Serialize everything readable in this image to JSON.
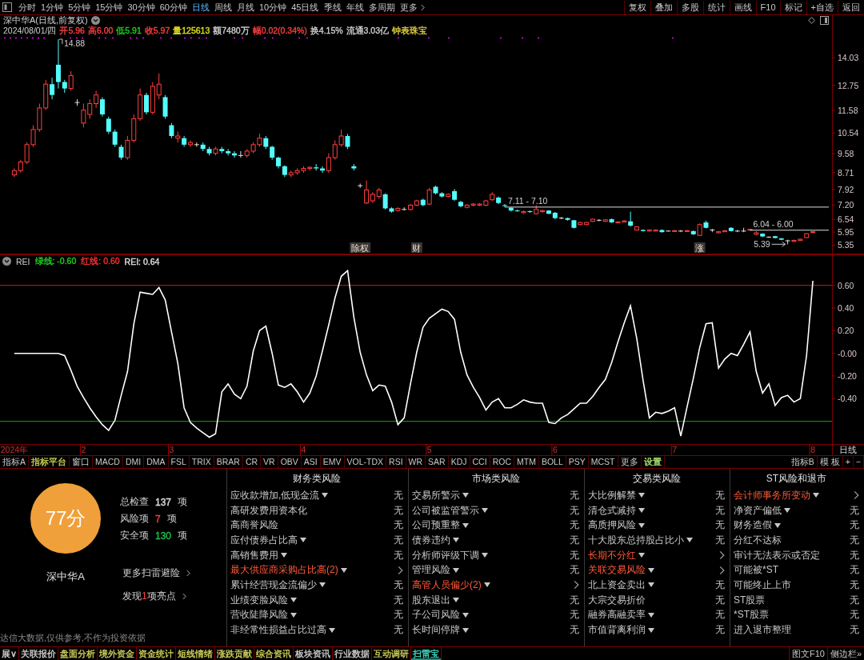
{
  "toolbar": {
    "periods": [
      {
        "label": "分时",
        "selected": false
      },
      {
        "label": "1分钟",
        "selected": false
      },
      {
        "label": "5分钟",
        "selected": false
      },
      {
        "label": "15分钟",
        "selected": false
      },
      {
        "label": "30分钟",
        "selected": false
      },
      {
        "label": "60分钟",
        "selected": false
      },
      {
        "label": "日线",
        "selected": true
      },
      {
        "label": "周线",
        "selected": false
      },
      {
        "label": "月线",
        "selected": false
      },
      {
        "label": "10分钟",
        "selected": false
      },
      {
        "label": "45日线",
        "selected": false
      },
      {
        "label": "季线",
        "selected": false
      },
      {
        "label": "年线",
        "selected": false
      },
      {
        "label": "多周期",
        "selected": false
      }
    ],
    "more": {
      "label": "更多"
    },
    "actions": [
      {
        "label": "复权"
      },
      {
        "label": "叠加"
      },
      {
        "label": "多股"
      },
      {
        "label": "统计"
      },
      {
        "label": "画线"
      },
      {
        "label": "F10"
      },
      {
        "label": "标记"
      },
      {
        "label": "+自选"
      },
      {
        "label": "返回"
      }
    ]
  },
  "price_pane": {
    "title": "深中华A(日线,前复权)",
    "quote": {
      "date": "2024/08/01/四",
      "fields": [
        {
          "text": "开5.96",
          "color": "#ff4040"
        },
        {
          "text": "高6.00",
          "color": "#ff4040"
        },
        {
          "text": "低5.91",
          "color": "#20d020"
        },
        {
          "text": "收5.97",
          "color": "#ff4040"
        },
        {
          "text": "量125613",
          "color": "#e0e020"
        },
        {
          "text": "额7480万",
          "color": "#d0d0d0"
        },
        {
          "text": "幅0.02(0.34%)",
          "color": "#ff4040"
        },
        {
          "text": "换4.15%",
          "color": "#d0d0d0"
        },
        {
          "text": "流通3.03亿",
          "color": "#d0d0d0"
        },
        {
          "text": "钟表珠宝",
          "color": "#e0d040"
        }
      ]
    },
    "chart_data": [
      {
        "type": "candlestick",
        "categories": [
          null,
          null,
          null,
          null,
          null,
          null,
          null,
          null,
          null,
          null,
          null,
          null,
          null,
          null,
          null,
          null,
          null,
          null,
          null,
          null,
          null,
          null,
          null,
          null,
          null,
          null,
          null,
          null,
          null,
          null,
          null,
          null,
          null,
          null,
          null,
          null,
          null,
          null,
          null,
          null,
          null,
          null,
          null,
          null,
          null,
          null,
          null,
          null,
          null,
          null,
          null,
          null,
          null,
          null,
          null,
          "除权",
          null,
          null,
          null,
          null,
          null,
          null,
          null,
          null,
          "财",
          null,
          null,
          null,
          null,
          null,
          null,
          null,
          null,
          null,
          null,
          null,
          null,
          null,
          null,
          null,
          null,
          null,
          null,
          null,
          null,
          null,
          null,
          null,
          null,
          null,
          null,
          null,
          null,
          null,
          null,
          null,
          null,
          null,
          null,
          null,
          null,
          null,
          null,
          null,
          null,
          null,
          null,
          null,
          null,
          "涨",
          null,
          null,
          null,
          null,
          null,
          null,
          null,
          null,
          null,
          null,
          null,
          null,
          null,
          null,
          null,
          null,
          null,
          null
        ],
        "ylim": [
          4.92,
          16.03
        ],
        "yticks": [
          14.03,
          12.75,
          11.58,
          10.54,
          9.58,
          8.71,
          7.92,
          {
            "value": 7.2,
            "label": "7.20"
          },
          6.54,
          5.95,
          5.35
        ],
        "ref_lines": [
          {
            "axis": "y",
            "value": 7.11,
            "label": "7.11 - 7.10",
            "color": "#e0e0e0"
          },
          {
            "axis": "y",
            "value": 6.04,
            "label": "6.04 - 6.00",
            "color": "#e0e0e0"
          }
        ],
        "ohlc": [
          [
            8.6,
            8.9,
            8.5,
            8.8
          ],
          [
            8.8,
            9.3,
            8.7,
            9.2
          ],
          [
            9.2,
            10.1,
            9.1,
            10.0
          ],
          [
            10.0,
            10.9,
            9.9,
            10.7
          ],
          [
            10.7,
            11.9,
            10.6,
            11.7
          ],
          [
            11.7,
            13.0,
            11.6,
            12.8
          ],
          [
            12.8,
            13.1,
            12.1,
            12.3
          ],
          [
            13.7,
            14.88,
            12.6,
            12.9
          ],
          [
            12.9,
            13.0,
            12.4,
            12.6
          ],
          [
            12.6,
            13.4,
            12.5,
            13.2
          ],
          [
            11.95,
            12.1,
            11.8,
            11.95
          ],
          [
            11.0,
            11.9,
            10.8,
            11.6
          ],
          [
            11.4,
            12.1,
            11.2,
            11.9
          ],
          [
            11.9,
            12.5,
            11.7,
            12.3
          ],
          [
            12.1,
            12.2,
            11.3,
            11.4
          ],
          [
            11.2,
            11.3,
            10.5,
            10.6
          ],
          [
            10.6,
            10.7,
            9.9,
            10.0
          ],
          [
            9.9,
            10.0,
            9.3,
            9.4
          ],
          [
            9.4,
            10.4,
            9.3,
            10.2
          ],
          [
            10.2,
            11.4,
            10.1,
            11.2
          ],
          [
            11.2,
            12.6,
            11.1,
            12.3
          ],
          [
            12.3,
            12.4,
            11.4,
            11.5
          ],
          [
            11.5,
            12.9,
            11.4,
            12.7
          ],
          [
            12.3,
            13.3,
            12.1,
            12.8
          ],
          [
            12.2,
            12.3,
            11.2,
            11.3
          ],
          [
            10.9,
            11.0,
            10.3,
            10.4
          ],
          [
            10.3,
            10.6,
            10.1,
            10.4
          ],
          [
            10.3,
            10.4,
            9.9,
            10.0
          ],
          [
            10.0,
            10.2,
            9.9,
            10.1
          ],
          [
            10.0,
            10.1,
            9.9,
            10.0
          ],
          [
            10.0,
            10.1,
            9.7,
            9.8
          ],
          [
            9.8,
            9.9,
            9.5,
            9.6
          ],
          [
            9.6,
            9.9,
            9.5,
            9.8
          ],
          [
            9.8,
            9.9,
            9.6,
            9.7
          ],
          [
            9.7,
            9.8,
            9.5,
            9.6
          ],
          [
            9.6,
            9.7,
            9.4,
            9.5
          ],
          [
            9.5,
            9.7,
            9.4,
            9.5
          ],
          [
            9.5,
            9.8,
            9.4,
            9.7
          ],
          [
            9.7,
            10.1,
            9.6,
            10.0
          ],
          [
            10.0,
            10.5,
            9.9,
            10.3
          ],
          [
            10.3,
            10.4,
            9.8,
            9.9
          ],
          [
            9.9,
            9.95,
            9.3,
            9.4
          ],
          [
            9.4,
            9.45,
            8.9,
            9.0
          ],
          [
            9.0,
            9.05,
            8.5,
            8.6
          ],
          [
            8.6,
            8.8,
            8.5,
            8.7
          ],
          [
            8.7,
            8.9,
            8.6,
            8.8
          ],
          [
            8.8,
            9.0,
            8.7,
            8.9
          ],
          [
            8.9,
            9.0,
            8.8,
            8.95
          ],
          [
            8.95,
            9.1,
            8.8,
            8.9
          ],
          [
            8.9,
            9.0,
            8.7,
            8.8
          ],
          [
            8.8,
            9.6,
            8.7,
            9.4
          ],
          [
            9.4,
            10.2,
            9.3,
            10.0
          ],
          [
            10.0,
            10.7,
            9.9,
            10.4
          ],
          [
            10.4,
            10.5,
            9.8,
            9.9
          ],
          [
            9.0,
            9.1,
            8.8,
            8.9
          ],
          [
            8.1,
            8.2,
            8.0,
            8.1
          ],
          [
            7.3,
            8.35,
            7.25,
            7.9
          ],
          [
            7.4,
            7.8,
            7.3,
            7.7
          ],
          [
            7.6,
            8.0,
            7.5,
            7.9
          ],
          [
            7.7,
            7.75,
            7.0,
            7.05
          ],
          [
            7.05,
            7.1,
            6.85,
            6.9
          ],
          [
            6.95,
            7.1,
            6.9,
            7.05
          ],
          [
            7.0,
            7.1,
            6.95,
            7.0
          ],
          [
            7.0,
            7.25,
            6.95,
            7.2
          ],
          [
            7.2,
            7.45,
            7.15,
            7.4
          ],
          [
            7.45,
            7.5,
            7.15,
            7.2
          ],
          [
            7.25,
            8.0,
            7.2,
            7.9
          ],
          [
            8.05,
            8.1,
            7.7,
            7.75
          ],
          [
            7.75,
            7.8,
            7.55,
            7.6
          ],
          [
            7.6,
            7.75,
            7.55,
            7.7
          ],
          [
            7.85,
            7.95,
            7.4,
            7.45
          ],
          [
            7.35,
            7.4,
            7.1,
            7.15
          ],
          [
            7.1,
            7.25,
            7.05,
            7.2
          ],
          [
            7.2,
            7.3,
            7.15,
            7.25
          ],
          [
            7.2,
            7.3,
            7.15,
            7.25
          ],
          [
            7.2,
            7.45,
            7.15,
            7.4
          ],
          [
            7.45,
            7.8,
            7.4,
            7.7
          ],
          [
            7.55,
            7.6,
            7.25,
            7.3
          ],
          [
            7.2,
            7.25,
            7.11,
            7.18
          ],
          [
            7.08,
            7.1,
            6.9,
            6.95
          ],
          [
            6.95,
            7.0,
            6.9,
            6.92
          ],
          [
            6.85,
            6.95,
            6.8,
            6.9
          ],
          [
            6.92,
            6.95,
            6.85,
            6.88
          ],
          [
            6.8,
            7.2,
            6.78,
            7.0
          ],
          [
            6.9,
            6.98,
            6.85,
            6.95
          ],
          [
            6.95,
            6.97,
            6.78,
            6.8
          ],
          [
            6.85,
            6.88,
            6.55,
            6.6
          ],
          [
            6.6,
            6.65,
            6.55,
            6.6
          ],
          [
            6.6,
            6.62,
            6.48,
            6.52
          ],
          [
            6.5,
            6.52,
            6.12,
            6.15
          ],
          [
            6.3,
            6.42,
            6.28,
            6.4
          ],
          [
            6.3,
            6.42,
            6.28,
            6.4
          ],
          [
            6.45,
            6.58,
            6.42,
            6.55
          ],
          [
            6.5,
            6.55,
            6.45,
            6.5
          ],
          [
            6.45,
            6.55,
            6.42,
            6.52
          ],
          [
            6.55,
            6.58,
            6.38,
            6.4
          ],
          [
            6.38,
            6.45,
            6.35,
            6.42
          ],
          [
            6.42,
            6.5,
            6.4,
            6.47
          ],
          [
            6.45,
            6.9,
            6.2,
            6.25
          ],
          [
            6.05,
            6.22,
            6.02,
            6.2
          ],
          [
            6.05,
            6.08,
            5.98,
            6.0
          ],
          [
            6.0,
            6.08,
            5.98,
            6.05
          ],
          [
            6.0,
            6.08,
            5.98,
            6.05
          ],
          [
            6.05,
            6.08,
            5.93,
            5.95
          ],
          [
            6.0,
            6.02,
            5.98,
            6.0
          ],
          [
            5.98,
            6.05,
            5.96,
            6.02
          ],
          [
            6.0,
            6.05,
            5.95,
            6.0
          ],
          [
            5.98,
            6.05,
            5.96,
            6.02
          ],
          [
            6.0,
            6.02,
            5.82,
            5.85
          ],
          [
            5.8,
            6.35,
            5.78,
            6.3
          ],
          [
            6.4,
            6.48,
            6.12,
            6.15
          ],
          [
            6.05,
            6.1,
            5.95,
            6.05
          ],
          [
            5.92,
            6.0,
            5.9,
            5.97
          ],
          [
            5.97,
            6.05,
            5.95,
            6.02
          ],
          [
            6.15,
            6.18,
            5.98,
            6.0
          ],
          [
            6.0,
            6.05,
            5.95,
            6.0
          ],
          [
            6.0,
            6.15,
            5.95,
            6.0
          ],
          [
            6.05,
            6.1,
            6.04,
            6.08
          ],
          [
            5.85,
            6.0,
            5.8,
            5.92
          ],
          [
            5.88,
            5.9,
            5.72,
            5.75
          ],
          [
            5.72,
            5.75,
            5.68,
            5.72
          ],
          [
            5.76,
            5.78,
            5.66,
            5.68
          ],
          [
            5.66,
            5.68,
            5.58,
            5.6
          ],
          [
            5.55,
            5.6,
            5.39,
            5.55
          ],
          [
            5.52,
            5.6,
            5.5,
            5.57
          ],
          [
            5.57,
            5.65,
            5.55,
            5.62
          ],
          [
            5.7,
            5.9,
            5.68,
            5.88
          ],
          [
            5.96,
            6.0,
            5.91,
            5.97
          ]
        ]
      }
    ],
    "extremes": {
      "high": "14.88",
      "low": "5.39"
    }
  },
  "rei_pane": {
    "header": {
      "items": [
        {
          "text": "绿线: -0.60",
          "color": "#20d020"
        },
        {
          "text": "红线: 0.60",
          "color": "#ff3030"
        },
        {
          "text": "REI: 0.64",
          "color": "#e0e0e0"
        }
      ]
    },
    "chart_data": [
      {
        "type": "line",
        "categories": [
          "2024年",
          null,
          null,
          null,
          null,
          null,
          null,
          null,
          null,
          null,
          null,
          "2",
          null,
          null,
          null,
          null,
          null,
          null,
          null,
          null,
          null,
          null,
          null,
          null,
          null,
          "3",
          null,
          null,
          null,
          null,
          null,
          null,
          null,
          null,
          null,
          null,
          null,
          null,
          null,
          null,
          null,
          null,
          null,
          null,
          null,
          null,
          "4",
          null,
          null,
          null,
          null,
          null,
          null,
          null,
          null,
          null,
          null,
          null,
          null,
          null,
          null,
          null,
          null,
          null,
          null,
          null,
          "5",
          null,
          null,
          null,
          null,
          null,
          null,
          null,
          null,
          null,
          null,
          null,
          null,
          null,
          null,
          null,
          null,
          null,
          null,
          null,
          "6",
          null,
          null,
          null,
          null,
          null,
          null,
          null,
          null,
          null,
          null,
          null,
          null,
          null,
          null,
          null,
          null,
          null,
          null,
          "7",
          null,
          null,
          null,
          null,
          null,
          null,
          null,
          null,
          null,
          null,
          null,
          null,
          null,
          null,
          null,
          null,
          null,
          null,
          null,
          null,
          null,
          "8"
        ],
        "series": [
          {
            "name": "REI",
            "color": "#ffffff",
            "values": [
              0,
              0,
              0,
              0,
              0,
              0,
              0,
              0,
              -0.02,
              -0.15,
              -0.29,
              -0.39,
              -0.48,
              -0.56,
              -0.63,
              -0.68,
              -0.59,
              -0.37,
              -0.16,
              0.26,
              0.54,
              0.53,
              0.52,
              0.58,
              0.47,
              0.19,
              -0.09,
              -0.48,
              -0.61,
              -0.66,
              -0.7,
              -0.74,
              -0.71,
              -0.34,
              -0.27,
              -0.36,
              -0.4,
              -0.29,
              0.02,
              0.2,
              0.24,
              0,
              -0.28,
              -0.3,
              -0.27,
              -0.34,
              -0.43,
              -0.35,
              -0.2,
              0.02,
              0.25,
              0.49,
              0.68,
              0.73,
              0.32,
              0.01,
              -0.19,
              -0.33,
              -0.28,
              -0.29,
              -0.43,
              -0.63,
              -0.57,
              -0.27,
              0.01,
              0.23,
              0.31,
              0.35,
              0.39,
              0.37,
              0.3,
              0.01,
              -0.19,
              -0.3,
              -0.39,
              -0.5,
              -0.43,
              -0.4,
              -0.48,
              -0.48,
              -0.45,
              -0.41,
              -0.43,
              -0.44,
              -0.44,
              -0.61,
              -0.62,
              -0.57,
              -0.54,
              -0.49,
              -0.44,
              -0.44,
              -0.38,
              -0.3,
              -0.23,
              -0.08,
              0.1,
              0.27,
              0.42,
              0.13,
              -0.24,
              -0.57,
              -0.52,
              -0.53,
              -0.51,
              -0.48,
              -0.73,
              -0.47,
              -0.22,
              0.05,
              0.26,
              0.27,
              -0.13,
              -0.05,
              0,
              -0.02,
              0.08,
              0.19,
              -0.16,
              -0.35,
              -0.27,
              -0.46,
              -0.39,
              -0.37,
              -0.43,
              -0.4,
              -0.02,
              0.64
            ]
          }
        ],
        "ylim": [
          -0.8,
          0.873
        ],
        "yticks": [
          {
            "value": 0.6,
            "label": "0.60"
          },
          {
            "value": 0.4,
            "label": "0.40"
          },
          {
            "value": 0.2,
            "label": "0.20"
          },
          {
            "value": 0,
            "label": "-0.00"
          },
          {
            "value": -0.2,
            "label": "-0.20"
          },
          {
            "value": -0.4,
            "label": "-0.40"
          }
        ],
        "ref_lines": [
          {
            "axis": "y",
            "value": 0.6,
            "color": "#c81e1e"
          },
          {
            "axis": "y",
            "value": -0.6,
            "color": "#1ea01e"
          }
        ]
      }
    ],
    "period_label": "日线"
  },
  "indicator_bar": {
    "left": [
      {
        "label": "指标A"
      },
      {
        "label": "指标平台",
        "color": "#c8d050"
      },
      {
        "label": "窗口"
      },
      {
        "label": "MACD"
      },
      {
        "label": "DMI"
      },
      {
        "label": "DMA"
      },
      {
        "label": "FSL"
      },
      {
        "label": "TRIX"
      },
      {
        "label": "BRAR"
      },
      {
        "label": "CR"
      },
      {
        "label": "VR"
      },
      {
        "label": "OBV"
      },
      {
        "label": "ASI"
      },
      {
        "label": "EMV"
      },
      {
        "label": "VOL-TDX"
      },
      {
        "label": "RSI"
      },
      {
        "label": "WR"
      },
      {
        "label": "SAR"
      },
      {
        "label": "KDJ"
      },
      {
        "label": "CCI"
      },
      {
        "label": "ROC"
      },
      {
        "label": "MTM"
      },
      {
        "label": "BOLL"
      },
      {
        "label": "PSY"
      },
      {
        "label": "MCST"
      },
      {
        "label": "更多"
      },
      {
        "label": "设置",
        "color": "#a8e070"
      }
    ],
    "right": [
      {
        "label": "指标B"
      },
      {
        "label": "模 板"
      },
      {
        "label": "+"
      },
      {
        "label": "−"
      }
    ]
  },
  "risk_scan": {
    "score": "77分",
    "stock": "深中华A",
    "stats": [
      {
        "label": "总检查",
        "value": "137",
        "unit": "项",
        "color": "#e0e0e0"
      },
      {
        "label": "风险项",
        "value": "7",
        "unit": "项",
        "color": "#ff4040"
      },
      {
        "label": "安全项",
        "value": "130",
        "unit": "项",
        "color": "#20c050"
      }
    ],
    "links": [
      {
        "text": "更多扫雷避险"
      },
      {
        "text": "发现",
        "count": "1",
        "after": "项亮点"
      }
    ],
    "disclaimer": "达信大数据,仅供参考,不作为投资依据",
    "columns": [
      {
        "title": "财务类风险",
        "items": [
          {
            "label": "应收款增加,低现金流",
            "dropdown": true,
            "risk": false,
            "result": "无"
          },
          {
            "label": "高研发费用资本化",
            "dropdown": false,
            "risk": false,
            "result": "无"
          },
          {
            "label": "高商誉风险",
            "dropdown": false,
            "risk": false,
            "result": "无"
          },
          {
            "label": "应付债券占比高",
            "dropdown": true,
            "risk": false,
            "result": "无"
          },
          {
            "label": "高销售费用",
            "dropdown": true,
            "risk": false,
            "result": "无"
          },
          {
            "label": "最大供应商采购占比高(2)",
            "dropdown": true,
            "risk": true
          },
          {
            "label": "累计经营现金流偏少",
            "dropdown": true,
            "risk": false,
            "result": "无"
          },
          {
            "label": "业绩变脸风险",
            "dropdown": true,
            "risk": false,
            "result": "无"
          },
          {
            "label": "营收陡降风险",
            "dropdown": true,
            "risk": false,
            "result": "无"
          },
          {
            "label": "非经常性损益占比过高",
            "dropdown": true,
            "risk": false,
            "result": "无"
          }
        ]
      },
      {
        "title": "市场类风险",
        "items": [
          {
            "label": "交易所警示",
            "dropdown": true,
            "risk": false,
            "result": "无"
          },
          {
            "label": "公司被监管警示",
            "dropdown": true,
            "risk": false,
            "result": "无"
          },
          {
            "label": "公司预重整",
            "dropdown": true,
            "risk": false,
            "result": "无"
          },
          {
            "label": "债券违约",
            "dropdown": true,
            "risk": false,
            "result": "无"
          },
          {
            "label": "分析师评级下调",
            "dropdown": true,
            "risk": false,
            "result": "无"
          },
          {
            "label": "管理风险",
            "dropdown": true,
            "risk": false,
            "result": "无"
          },
          {
            "label": "高管人员偏少(2)",
            "dropdown": true,
            "risk": true
          },
          {
            "label": "股东退出",
            "dropdown": true,
            "risk": false,
            "result": "无"
          },
          {
            "label": "子公司风险",
            "dropdown": true,
            "risk": false,
            "result": "无"
          },
          {
            "label": "长时间停牌",
            "dropdown": true,
            "risk": false,
            "result": "无"
          }
        ]
      },
      {
        "title": "交易类风险",
        "items": [
          {
            "label": "大比例解禁",
            "dropdown": true,
            "risk": false,
            "result": "无"
          },
          {
            "label": "清仓式减持",
            "dropdown": true,
            "risk": false,
            "result": "无"
          },
          {
            "label": "高质押风险",
            "dropdown": true,
            "risk": false,
            "result": "无"
          },
          {
            "label": "十大股东总持股占比小",
            "dropdown": true,
            "risk": false,
            "result": "无"
          },
          {
            "label": "长期不分红",
            "dropdown": true,
            "risk": true
          },
          {
            "label": "关联交易风险",
            "dropdown": true,
            "risk": true
          },
          {
            "label": "北上资金卖出",
            "dropdown": true,
            "risk": false,
            "result": "无"
          },
          {
            "label": "大宗交易折价",
            "dropdown": false,
            "risk": false,
            "result": "无"
          },
          {
            "label": "融券高融卖率",
            "dropdown": true,
            "risk": false,
            "result": "无"
          },
          {
            "label": "市值背离利润",
            "dropdown": true,
            "risk": false,
            "result": "无"
          }
        ]
      },
      {
        "title": "ST风险和退市",
        "items": [
          {
            "label": "会计师事务所变动",
            "dropdown": true,
            "risk": true
          },
          {
            "label": "净资产偏低",
            "dropdown": true,
            "risk": false,
            "result": "无"
          },
          {
            "label": "财务造假",
            "dropdown": true,
            "risk": false,
            "result": "无"
          },
          {
            "label": "分红不达标",
            "dropdown": false,
            "risk": false,
            "result": "无"
          },
          {
            "label": "审计无法表示或否定",
            "dropdown": false,
            "risk": false,
            "result": "无"
          },
          {
            "label": "可能被*ST",
            "dropdown": false,
            "risk": false,
            "result": "无"
          },
          {
            "label": "可能终止上市",
            "dropdown": false,
            "risk": false,
            "result": "无"
          },
          {
            "label": "ST股票",
            "dropdown": false,
            "risk": false,
            "result": "无"
          },
          {
            "label": "*ST股票",
            "dropdown": false,
            "risk": false,
            "result": "无"
          },
          {
            "label": "进入退市整理",
            "dropdown": false,
            "risk": false,
            "result": "无"
          }
        ]
      }
    ]
  },
  "bottom_tabs": {
    "tabs": [
      {
        "label": "展∨",
        "selected": false,
        "color": "#d0d0d0"
      },
      {
        "label": "关联报价",
        "selected": false,
        "color": "#d0d0d0"
      },
      {
        "label": "盘面分析",
        "selected": false,
        "color": "#d2d25a"
      },
      {
        "label": "境外资金",
        "selected": false,
        "color": "#d2d25a"
      },
      {
        "label": "资金统计",
        "selected": false,
        "color": "#d2d25a"
      },
      {
        "label": "短线情绪",
        "selected": false,
        "color": "#d2d25a"
      },
      {
        "label": "涨跌贡献",
        "selected": false,
        "color": "#d2d25a"
      },
      {
        "label": "综合资讯",
        "selected": false,
        "color": "#d2d25a"
      },
      {
        "label": "板块资讯",
        "selected": false,
        "color": "#d0d0d0"
      },
      {
        "label": "行业数据",
        "selected": false,
        "color": "#d0d0d0"
      },
      {
        "label": "互动调研",
        "selected": false,
        "color": "#d2d25a"
      },
      {
        "label": "扫雷宝",
        "selected": true,
        "color": "#40e0c8"
      }
    ],
    "side": [
      {
        "label": "图文F10"
      },
      {
        "label": "侧边栏»"
      }
    ]
  }
}
